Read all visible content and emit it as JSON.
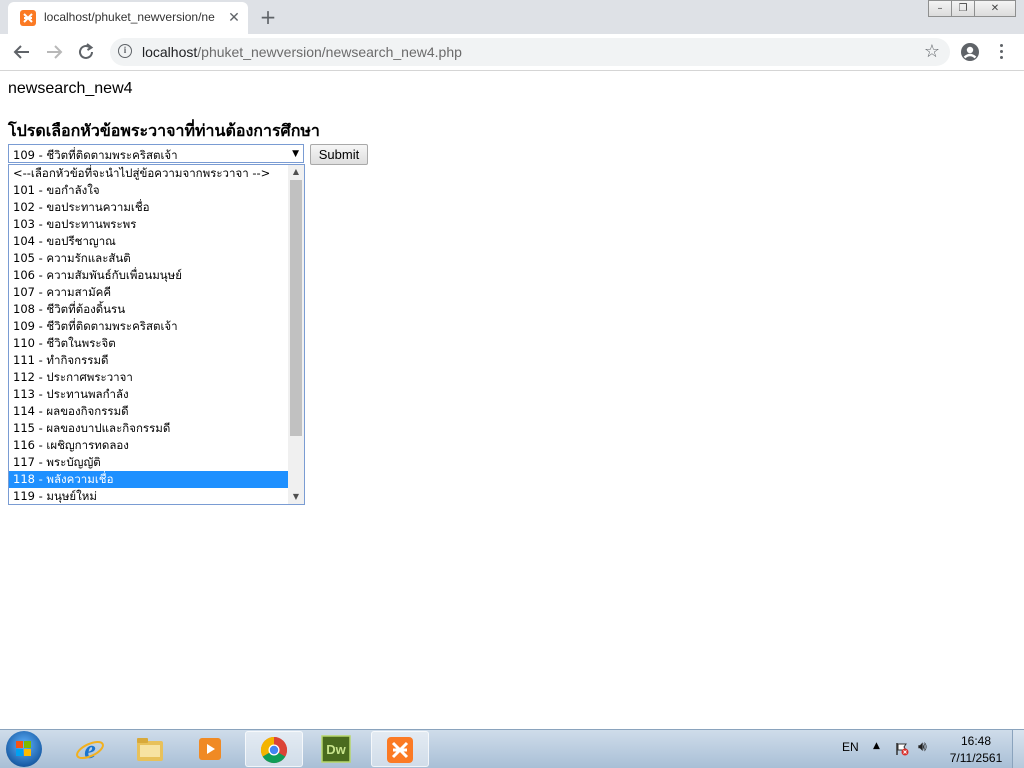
{
  "browser": {
    "tab_title": "localhost/phuket_newversion/ne",
    "tab_close_glyph": "✕",
    "new_tab_glyph": "+",
    "url_host": "localhost",
    "url_path": "/phuket_newversion/newsearch_new4.php"
  },
  "page": {
    "heading": "newsearch_new4",
    "instruction": "โปรดเลือกหัวข้อพระวาจาที่ท่านต้องการศึกษา",
    "select_value": "109 - ชีวิตที่ติดตามพระคริสตเจ้า",
    "submit_label": "Submit",
    "options": [
      "<--เลือกหัวข้อที่จะนำไปสู่ข้อความจากพระวาจา -->",
      "101 - ขอกำลังใจ",
      "102 - ขอประทานความเชื่อ",
      "103 - ขอประทานพระพร",
      "104 - ขอปรีชาญาณ",
      "105 - ความรักและสันติ",
      "106 - ความสัมพันธ์กับเพื่อนมนุษย์",
      "107 - ความสามัคคี",
      "108 - ชีวิตที่ต้องดิ้นรน",
      "109 - ชีวิตที่ติดตามพระคริสตเจ้า",
      "110 - ชีวิตในพระจิต",
      "111 - ทำกิจกรรมดี",
      "112 - ประกาศพระวาจา",
      "113 - ประทานพลกำลัง",
      "114 - ผลของกิจกรรมดี",
      "115 - ผลของบาปและกิจกรรมดี",
      "116 - เผชิญการทดลอง",
      "117 - พระบัญญัติ",
      "118 - พลังความเชื่อ",
      "119 - มนุษย์ใหม่"
    ],
    "highlighted_option": "118 - พลังความเชื่อ"
  },
  "taskbar": {
    "language": "EN",
    "time": "16:48",
    "date": "7/11/2561",
    "dreamweaver_label": "Dw"
  },
  "colors": {
    "accent": "#1e90ff",
    "xampp": "#fb7a24"
  }
}
